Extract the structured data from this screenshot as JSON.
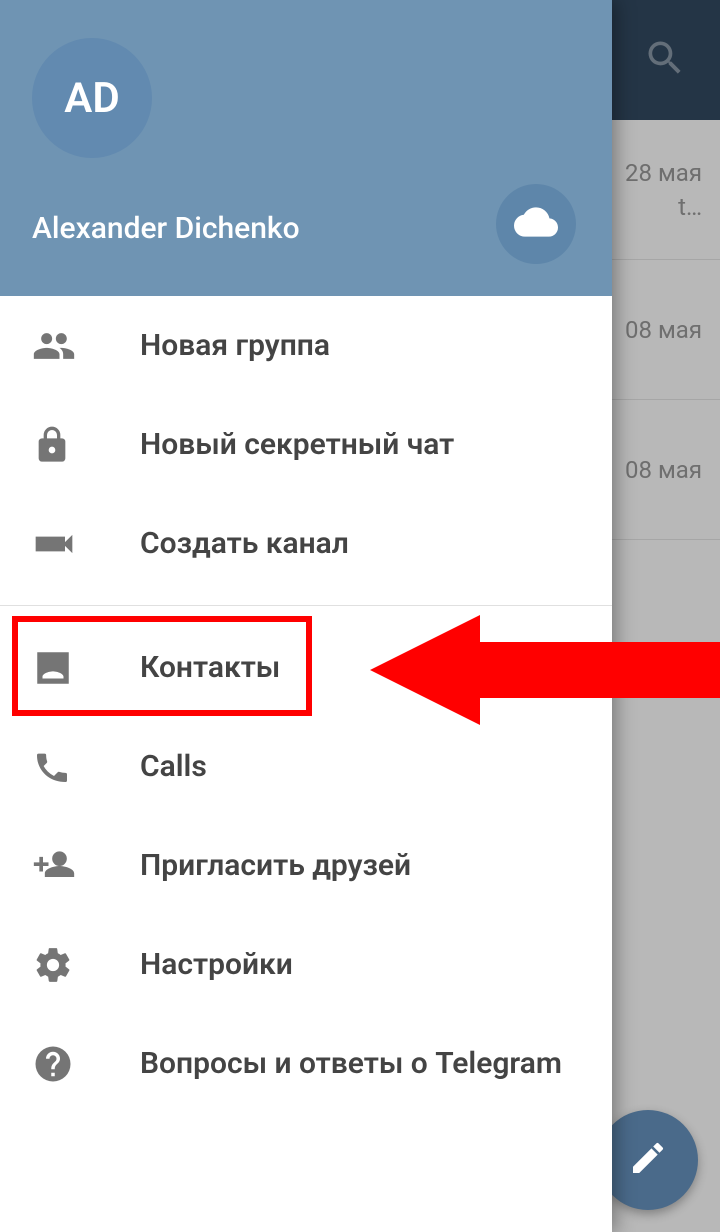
{
  "profile": {
    "initials": "AD",
    "name": "Alexander Dichenko"
  },
  "menu": {
    "new_group": "Новая группа",
    "new_secret_chat": "Новый секретный чат",
    "new_channel": "Создать канал",
    "contacts": "Контакты",
    "calls": "Calls",
    "invite_friends": "Пригласить друзей",
    "settings": "Настройки",
    "faq": "Вопросы и ответы о Telegram"
  },
  "chat_peek": {
    "date1": "28 мая",
    "preview1": "t…",
    "date2": "08 мая",
    "date3": "08 мая"
  }
}
